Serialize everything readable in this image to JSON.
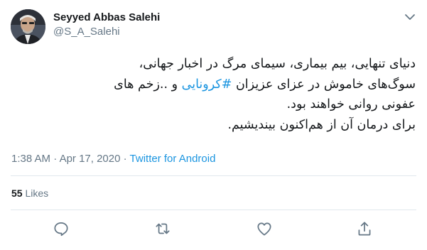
{
  "author": {
    "display_name": "Seyyed Abbas Salehi",
    "handle": "@S_A_Salehi"
  },
  "tweet": {
    "lines": [
      [
        "دنیای تنهایی، بیم بیماری، سیمای مرگ در اخبار جهانی،"
      ],
      [
        "سوگ‌های خاموش در عزای عزیزان ",
        "#کرونایی",
        " و ..زخم های"
      ],
      [
        "عفونی روانی خواهند بود."
      ],
      [
        "برای درمان آن از هم‌اکنون بیندیشیم."
      ]
    ]
  },
  "meta": {
    "time": "1:38 AM",
    "separator1": " · ",
    "date": "Apr 17, 2020",
    "separator2": " · ",
    "source": "Twitter for Android"
  },
  "stats": {
    "likes_count": "55",
    "likes_label": "Likes"
  },
  "icons": {
    "more": "chevron-down-icon",
    "reply": "reply-icon",
    "retweet": "retweet-icon",
    "like": "heart-icon",
    "share": "share-icon"
  },
  "colors": {
    "text": "#14171a",
    "secondary": "#657786",
    "link": "#1b95e0",
    "divider": "#e1e8ed"
  }
}
